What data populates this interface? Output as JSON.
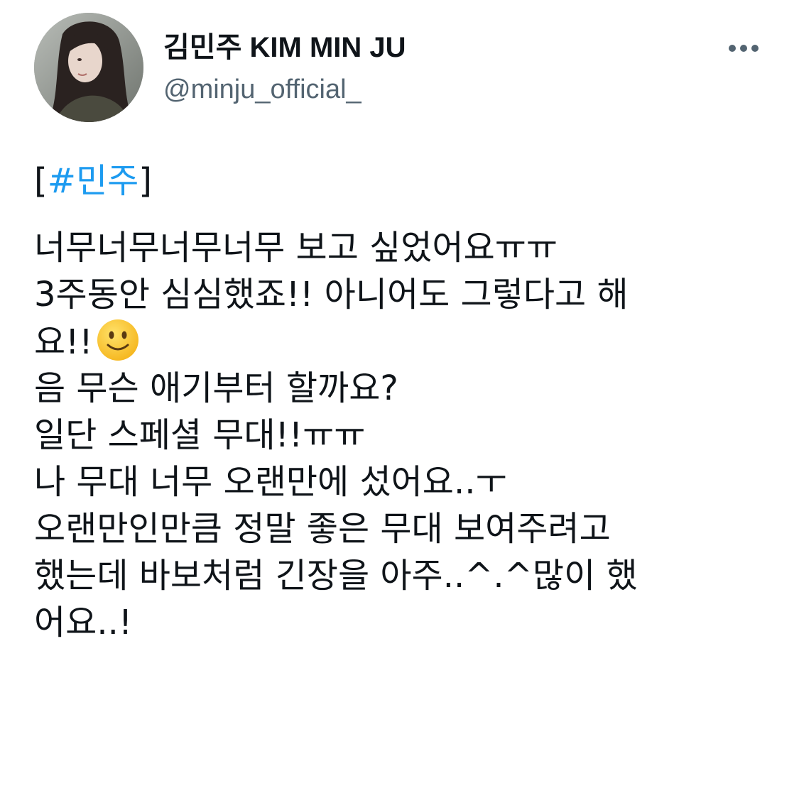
{
  "author": {
    "display_name": "김민주 KIM MIN JU",
    "handle": "@minju_official_"
  },
  "icons": {
    "more": "more-horizontal-icon",
    "emoji": "slightly-smiling-face-emoji"
  },
  "tweet": {
    "bracket_open": "[",
    "hashtag": "#민주",
    "bracket_close": "]",
    "lines": [
      "너무너무너무너무 보고 싶었어요ㅠㅠ",
      "3주동안 심심했죠!! 아니어도 그렇다고 해",
      "요!!",
      "음 무슨 애기부터 할까요?",
      "일단 스페셜 무대!!ㅠㅠ",
      "나 무대 너무 오랜만에 섰어요..ㅜ",
      "오랜만인만큼 정말 좋은 무대 보여주려고",
      "했는데 바보처럼 긴장을 아주..^.^많이 했",
      "어요..!"
    ]
  },
  "colors": {
    "text": "#0f1419",
    "secondary": "#536471",
    "link": "#1d9bf0"
  }
}
